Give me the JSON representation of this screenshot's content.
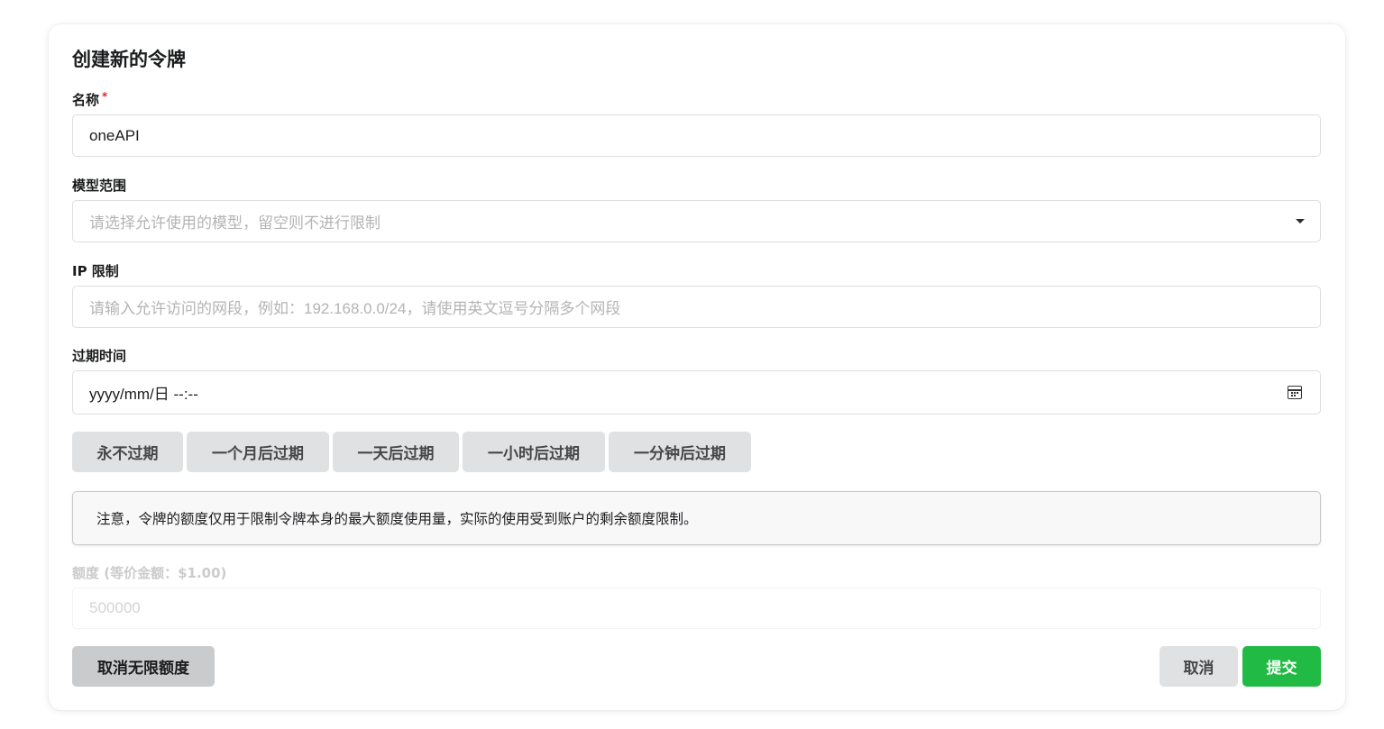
{
  "form": {
    "title": "创建新的令牌",
    "name": {
      "label": "名称",
      "required_mark": "*",
      "value": "oneAPI"
    },
    "models": {
      "label": "模型范围",
      "placeholder": "请选择允许使用的模型，留空则不进行限制"
    },
    "ip": {
      "label": "IP 限制",
      "placeholder": "请输入允许访问的网段，例如：192.168.0.0/24，请使用英文逗号分隔多个网段"
    },
    "expire": {
      "label": "过期时间",
      "value": "yyyy/mm/日 --:--"
    },
    "quick_expire": [
      {
        "label": "永不过期"
      },
      {
        "label": "一个月后过期"
      },
      {
        "label": "一天后过期"
      },
      {
        "label": "一小时后过期"
      },
      {
        "label": "一分钟后过期"
      }
    ],
    "notice": "注意，令牌的额度仅用于限制令牌本身的最大额度使用量，实际的使用受到账户的剩余额度限制。",
    "quota": {
      "label": "额度 (等价金额：$1.00)",
      "placeholder": "500000"
    },
    "buttons": {
      "unlimited": "取消无限额度",
      "cancel": "取消",
      "submit": "提交"
    }
  },
  "colors": {
    "submit": "#21ba45",
    "required": "#db2828",
    "button_bg": "#e0e1e2"
  }
}
